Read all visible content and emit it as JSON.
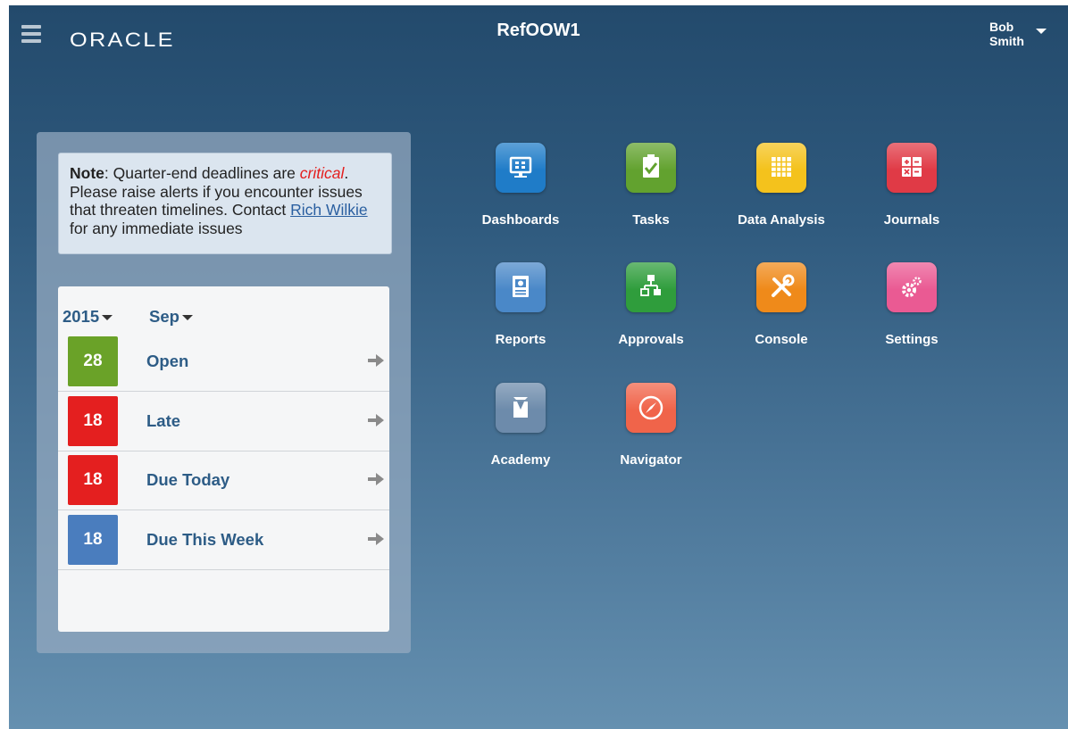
{
  "header": {
    "logo_text": "ORACLE",
    "app_title": "RefOOW1",
    "user_first": "Bob",
    "user_last": "Smith"
  },
  "note": {
    "bold": "Note",
    "text1": ": Quarter-end deadlines are ",
    "critical": "critical",
    "text2": ". Please raise alerts if you encounter issues that threaten timelines. Contact ",
    "link": "Rich Wilkie",
    "text3": " for any immediate issues"
  },
  "tasks": {
    "year": "2015",
    "month": "Sep",
    "rows": [
      {
        "count": "28",
        "label": "Open",
        "color": "#6aa228"
      },
      {
        "count": "18",
        "label": "Late",
        "color": "#e41f1f"
      },
      {
        "count": "18",
        "label": "Due Today",
        "color": "#e41f1f"
      },
      {
        "count": "18",
        "label": "Due This Week",
        "color": "#4a7dbe"
      }
    ]
  },
  "tiles": [
    {
      "label": "Dashboards",
      "icon": "dashboard-icon",
      "color": "#1f7cc8"
    },
    {
      "label": "Tasks",
      "icon": "tasks-icon",
      "color": "#62a22f"
    },
    {
      "label": "Data Analysis",
      "icon": "data-analysis-icon",
      "color": "#f4c21c"
    },
    {
      "label": "Journals",
      "icon": "journals-icon",
      "color": "#e03a46"
    },
    {
      "label": "Reports",
      "icon": "reports-icon",
      "color": "#4a88c8"
    },
    {
      "label": "Approvals",
      "icon": "approvals-icon",
      "color": "#2f9d3c"
    },
    {
      "label": "Console",
      "icon": "console-icon",
      "color": "#ef8a1a"
    },
    {
      "label": "Settings",
      "icon": "settings-icon",
      "color": "#ea5a93"
    },
    {
      "label": "Academy",
      "icon": "academy-icon",
      "color": "#6d8bab"
    },
    {
      "label": "Navigator",
      "icon": "navigator-icon",
      "color": "#f0644a"
    }
  ]
}
